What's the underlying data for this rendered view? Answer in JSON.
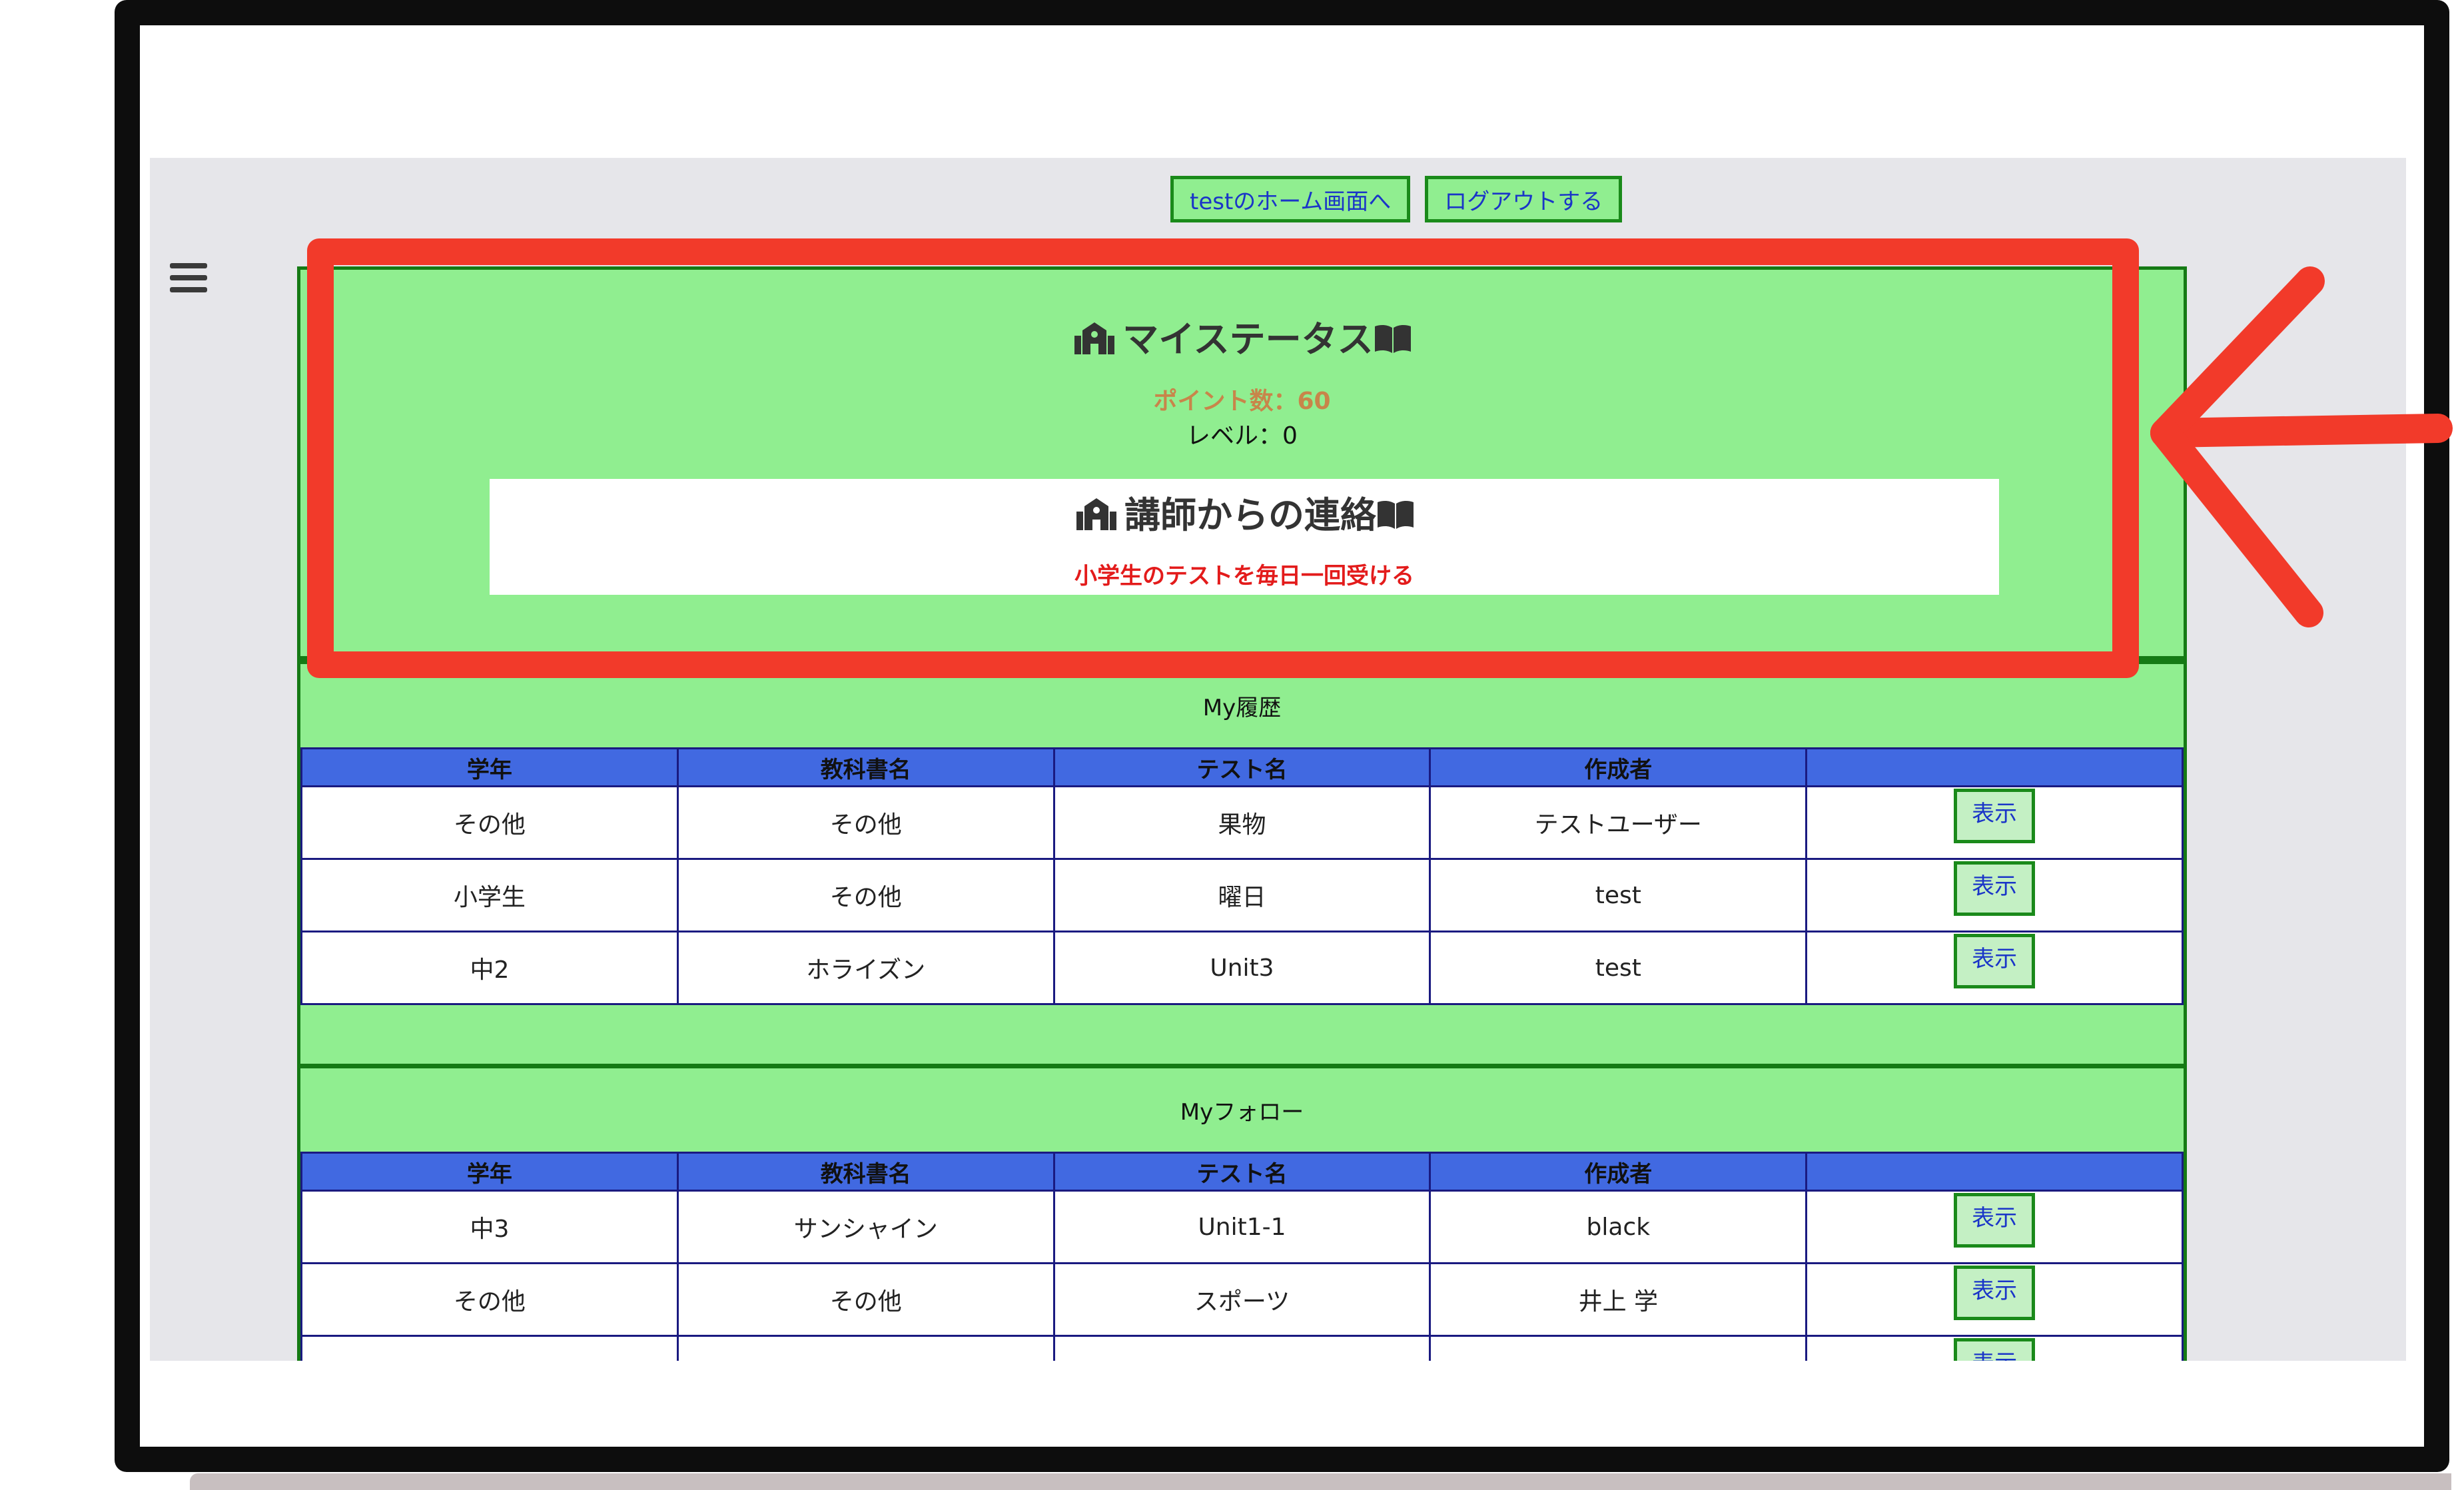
{
  "top_links": {
    "home": "testのホーム画面へ",
    "logout": "ログアウトする"
  },
  "status": {
    "title": "マイステータス",
    "points": "ポイント数：60",
    "level": "レベル：0",
    "notice_title": "講師からの連絡",
    "notice_text": "小学生のテストを毎日一回受ける"
  },
  "history": {
    "title": "My履歴",
    "headers": [
      "学年",
      "教科書名",
      "テスト名",
      "作成者",
      ""
    ],
    "rows": [
      [
        "その他",
        "その他",
        "果物",
        "テストユーザー",
        "表示"
      ],
      [
        "小学生",
        "その他",
        "曜日",
        "test",
        "表示"
      ],
      [
        "中2",
        "ホライズン",
        "Unit3",
        "test",
        "表示"
      ]
    ]
  },
  "follow": {
    "title": "Myフォロー",
    "headers": [
      "学年",
      "教科書名",
      "テスト名",
      "作成者",
      ""
    ],
    "rows": [
      [
        "中3",
        "サンシャイン",
        "Unit1-1",
        "black",
        "表示"
      ],
      [
        "その他",
        "その他",
        "スポーツ",
        "井上 学",
        "表示"
      ],
      [
        "",
        "",
        "",
        "",
        "表示"
      ]
    ]
  },
  "colors": {
    "panel_green": "#90ee90",
    "border_green": "#157a15",
    "header_blue": "#4169e1",
    "annotation_red": "#f23a2a",
    "link_blue": "#1a35c8"
  }
}
